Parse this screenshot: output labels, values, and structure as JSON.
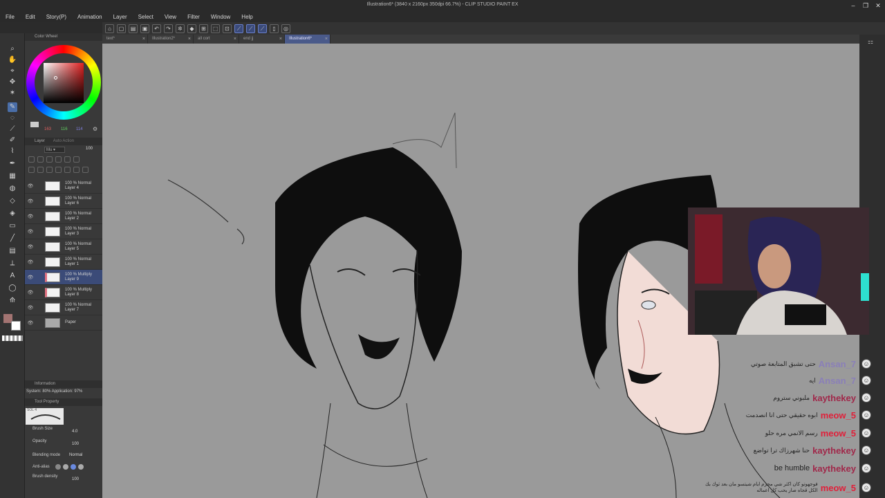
{
  "window": {
    "title": "Illustration6* (3840 x 2160px 350dpi 66.7%) - CLIP STUDIO PAINT EX"
  },
  "menu": [
    "File",
    "Edit",
    "Story(P)",
    "Animation",
    "Layer",
    "Select",
    "View",
    "Filter",
    "Window",
    "Help"
  ],
  "tabs": [
    {
      "label": "text*",
      "active": false
    },
    {
      "label": "Illustration2*",
      "active": false
    },
    {
      "label": "all cort",
      "active": false
    },
    {
      "label": "end jj",
      "active": false
    },
    {
      "label": "Illustration6*",
      "active": true
    }
  ],
  "color_wheel": {
    "title": "Color Wheel",
    "r": "163",
    "g": "116",
    "b": "114",
    "current_color": "#a37472"
  },
  "layer_panel": {
    "tab1": "Layer",
    "tab2": "Auto Action",
    "opacity_value": "100",
    "layers": [
      {
        "mode": "100 % Normal",
        "name": "Layer 4"
      },
      {
        "mode": "100 % Normal",
        "name": "Layer 6"
      },
      {
        "mode": "100 % Normal",
        "name": "Layer 2"
      },
      {
        "mode": "100 % Normal",
        "name": "Layer 3"
      },
      {
        "mode": "100 % Normal",
        "name": "Layer 5"
      },
      {
        "mode": "100 % Normal",
        "name": "Layer 1"
      },
      {
        "mode": "100 % Multiply",
        "name": "Layer 9",
        "selected": true
      },
      {
        "mode": "100 % Multiply",
        "name": "Layer 8"
      },
      {
        "mode": "100 % Normal",
        "name": "Layer 7"
      },
      {
        "mode": "",
        "name": "Paper"
      }
    ]
  },
  "info_panel": {
    "title": "Information",
    "status": "System: 80% Application: 97%"
  },
  "tool_property": {
    "title": "Tool Property",
    "brush_label": "SOL 4",
    "brush_size_label": "Brush Size",
    "brush_size_value": "4.0",
    "opacity_label": "Opacity",
    "opacity_value": "100",
    "blending_label": "Blending mode",
    "blending_value": "Normal",
    "antialias_label": "Anti-alias",
    "density_label": "Brush density",
    "density_value": "100"
  },
  "chat": [
    {
      "user": "Ansan_7",
      "message": "حتى تشبق المتابعة صوتي",
      "color": "#8a7fb8"
    },
    {
      "user": "Ansan_7",
      "message": "ايه",
      "color": "#8a7fb8"
    },
    {
      "user": "kaythekey",
      "message": "ملبوني ستروم",
      "color": "#a0284a"
    },
    {
      "user": "meow_5",
      "message": "ابوه حقيقي حتى انا انصدمت",
      "color": "#e0203a"
    },
    {
      "user": "meow_5",
      "message": "رسم الانمي مره حلو",
      "color": "#e0203a"
    },
    {
      "user": "kaythekey",
      "message": "حنا شهرزاك ترا تواضع",
      "color": "#a0284a"
    },
    {
      "user": "kaythekey",
      "message": "be humble",
      "color": "#a0284a"
    },
    {
      "user": "meow_5",
      "message": "فوجهوتو كان اكثر شي محرم ايام شيتسو مان بعد ثوك بك الكل قجاه صار يحب كل اعماله",
      "color": "#e0203a"
    }
  ],
  "colors": {
    "accent": "#4a6ea8",
    "canvas_bg": "#9a9a9a",
    "panel_bg": "#393939"
  }
}
